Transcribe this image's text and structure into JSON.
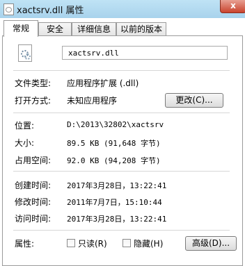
{
  "window": {
    "title": "xactsrv.dll 属性",
    "close_label": "x"
  },
  "tabs": [
    {
      "label": "常规"
    },
    {
      "label": "安全"
    },
    {
      "label": "详细信息"
    },
    {
      "label": "以前的版本"
    }
  ],
  "general": {
    "filename": "xactsrv.dll",
    "file_type_label": "文件类型:",
    "file_type_value": "应用程序扩展 (.dll)",
    "open_with_label": "打开方式:",
    "open_with_value": "未知应用程序",
    "change_button": "更改(C)...",
    "location_label": "位置:",
    "location_value": "D:\\2013\\32802\\xactsrv",
    "size_label": "大小:",
    "size_value": "89.5 KB (91,648 字节)",
    "size_on_disk_label": "占用空间:",
    "size_on_disk_value": "92.0 KB (94,208 字节)",
    "created_label": "创建时间:",
    "created_value": "2017年3月28日，13:22:41",
    "modified_label": "修改时间:",
    "modified_value": "2011年7月7日，15:10:44",
    "accessed_label": "访问时间:",
    "accessed_value": "2017年3月28日，13:22:41",
    "attributes_label": "属性:",
    "readonly_label": "只读(R)",
    "hidden_label": "隐藏(H)",
    "advanced_button": "高级(D)..."
  }
}
